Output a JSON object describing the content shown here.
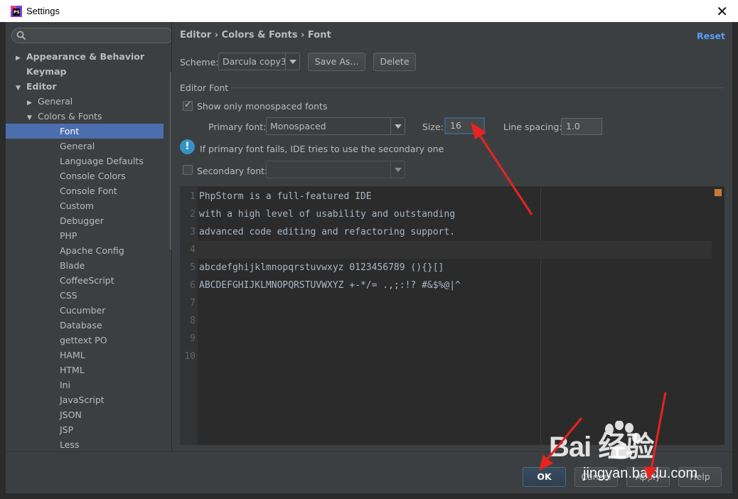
{
  "window": {
    "title": "Settings",
    "close_icon": "close-icon"
  },
  "search": {
    "placeholder": "",
    "icon": "search-icon"
  },
  "tree": [
    {
      "label": "Appearance & Behavior",
      "level": 0,
      "arrow": "right",
      "bold": true
    },
    {
      "label": "Keymap",
      "level": 0,
      "arrow": "",
      "bold": true
    },
    {
      "label": "Editor",
      "level": 0,
      "arrow": "down",
      "bold": true
    },
    {
      "label": "General",
      "level": 1,
      "arrow": "right"
    },
    {
      "label": "Colors & Fonts",
      "level": 1,
      "arrow": "down"
    },
    {
      "label": "Font",
      "level": 2,
      "arrow": "",
      "selected": true
    },
    {
      "label": "General",
      "level": 2,
      "arrow": ""
    },
    {
      "label": "Language Defaults",
      "level": 2,
      "arrow": ""
    },
    {
      "label": "Console Colors",
      "level": 2,
      "arrow": ""
    },
    {
      "label": "Console Font",
      "level": 2,
      "arrow": ""
    },
    {
      "label": "Custom",
      "level": 2,
      "arrow": ""
    },
    {
      "label": "Debugger",
      "level": 2,
      "arrow": ""
    },
    {
      "label": "PHP",
      "level": 2,
      "arrow": ""
    },
    {
      "label": "Apache Config",
      "level": 2,
      "arrow": ""
    },
    {
      "label": "Blade",
      "level": 2,
      "arrow": ""
    },
    {
      "label": "CoffeeScript",
      "level": 2,
      "arrow": ""
    },
    {
      "label": "CSS",
      "level": 2,
      "arrow": ""
    },
    {
      "label": "Cucumber",
      "level": 2,
      "arrow": ""
    },
    {
      "label": "Database",
      "level": 2,
      "arrow": ""
    },
    {
      "label": "gettext PO",
      "level": 2,
      "arrow": ""
    },
    {
      "label": "HAML",
      "level": 2,
      "arrow": ""
    },
    {
      "label": "HTML",
      "level": 2,
      "arrow": ""
    },
    {
      "label": "Ini",
      "level": 2,
      "arrow": ""
    },
    {
      "label": "JavaScript",
      "level": 2,
      "arrow": ""
    },
    {
      "label": "JSON",
      "level": 2,
      "arrow": ""
    },
    {
      "label": "JSP",
      "level": 2,
      "arrow": ""
    },
    {
      "label": "Less",
      "level": 2,
      "arrow": ""
    }
  ],
  "header": {
    "breadcrumb": "Editor › Colors & Fonts › Font",
    "reset_label": "Reset"
  },
  "scheme": {
    "label": "Scheme:",
    "value": "Darcula copy3",
    "save_as_label": "Save As...",
    "delete_label": "Delete"
  },
  "editor_font": {
    "section_title": "Editor Font",
    "mono_only_label": "Show only monospaced fonts",
    "mono_only_checked": true,
    "primary_font_label": "Primary font:",
    "primary_font_value": "Monospaced",
    "size_label": "Size:",
    "size_value": "16",
    "line_spacing_label": "Line spacing:",
    "line_spacing_value": "1.0",
    "info_text": "If primary font fails, IDE tries to use the secondary one",
    "secondary_font_label": "Secondary font:",
    "secondary_font_checked": false,
    "secondary_font_value": ""
  },
  "preview": {
    "lines": [
      {
        "num": "1",
        "text": "PhpStorm is a full-featured IDE"
      },
      {
        "num": "2",
        "text": "with a high level of usability and outstanding"
      },
      {
        "num": "3",
        "text": "advanced code editing and refactoring support."
      },
      {
        "num": "4",
        "text": ""
      },
      {
        "num": "5",
        "text": "abcdefghijklmnopqrstuvwxyz 0123456789 (){}[]"
      },
      {
        "num": "6",
        "text": "ABCDEFGHIJKLMNOPQRSTUVWXYZ +-*/= .,;:!? #&$%@|^"
      },
      {
        "num": "7",
        "text": ""
      },
      {
        "num": "8",
        "text": ""
      },
      {
        "num": "9",
        "text": ""
      },
      {
        "num": "10",
        "text": ""
      }
    ],
    "current_line": 4
  },
  "footer": {
    "ok_label": "OK",
    "cancel_label": "Cancel",
    "apply_label": "Apply",
    "help_label": "Help"
  },
  "watermark": {
    "logo_text": "Bai  经验",
    "url_text": "jingyan.baidu.com"
  },
  "colors": {
    "accent": "#4b6eaf",
    "link": "#589df6",
    "annotation_arrow": "#e8231f"
  }
}
